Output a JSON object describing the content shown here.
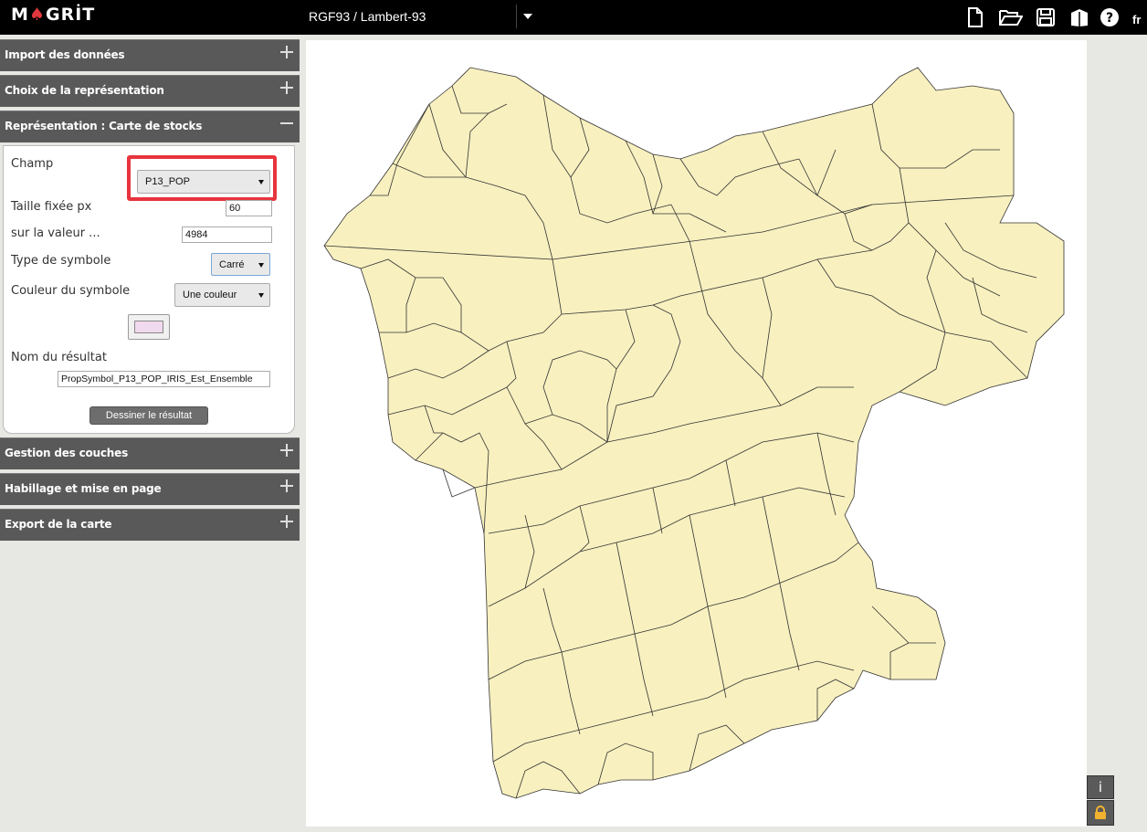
{
  "app": {
    "logo_text_1": "M",
    "logo_text_2": "GRİT",
    "projection": "RGF93 / Lambert-93",
    "language": "fr"
  },
  "toolbar_icons": [
    "new-file-icon",
    "open-folder-icon",
    "save-icon",
    "book-icon",
    "help-icon"
  ],
  "sidebar": {
    "sections": [
      {
        "title": "Import des données",
        "expanded": false
      },
      {
        "title": "Choix de la représentation",
        "expanded": false
      },
      {
        "title": "Représentation : Carte de stocks",
        "expanded": true
      },
      {
        "title": "Gestion des couches",
        "expanded": false
      },
      {
        "title": "Habillage et mise en page",
        "expanded": false
      },
      {
        "title": "Export de la carte",
        "expanded": false
      }
    ]
  },
  "form": {
    "champ_label": "Champ",
    "champ_value": "P13_POP",
    "taille_label": "Taille fixée px",
    "taille_value": "60",
    "valeur_label": "sur la valeur ...",
    "valeur_value": "4984",
    "type_label": "Type de symbole",
    "type_value": "Carré",
    "couleur_label": "Couleur du symbole",
    "couleur_value": "Une couleur",
    "symbol_color": "#f1d9ee",
    "nom_label": "Nom du résultat",
    "nom_value": "PropSymbol_P13_POP_IRIS_Est_Ensemble",
    "draw_button": "Dessiner le résultat"
  },
  "map": {
    "fill_color": "#f8f0bf",
    "stroke_color": "#333333"
  },
  "corner_buttons": {
    "info": "i",
    "lock": "lock-icon"
  }
}
